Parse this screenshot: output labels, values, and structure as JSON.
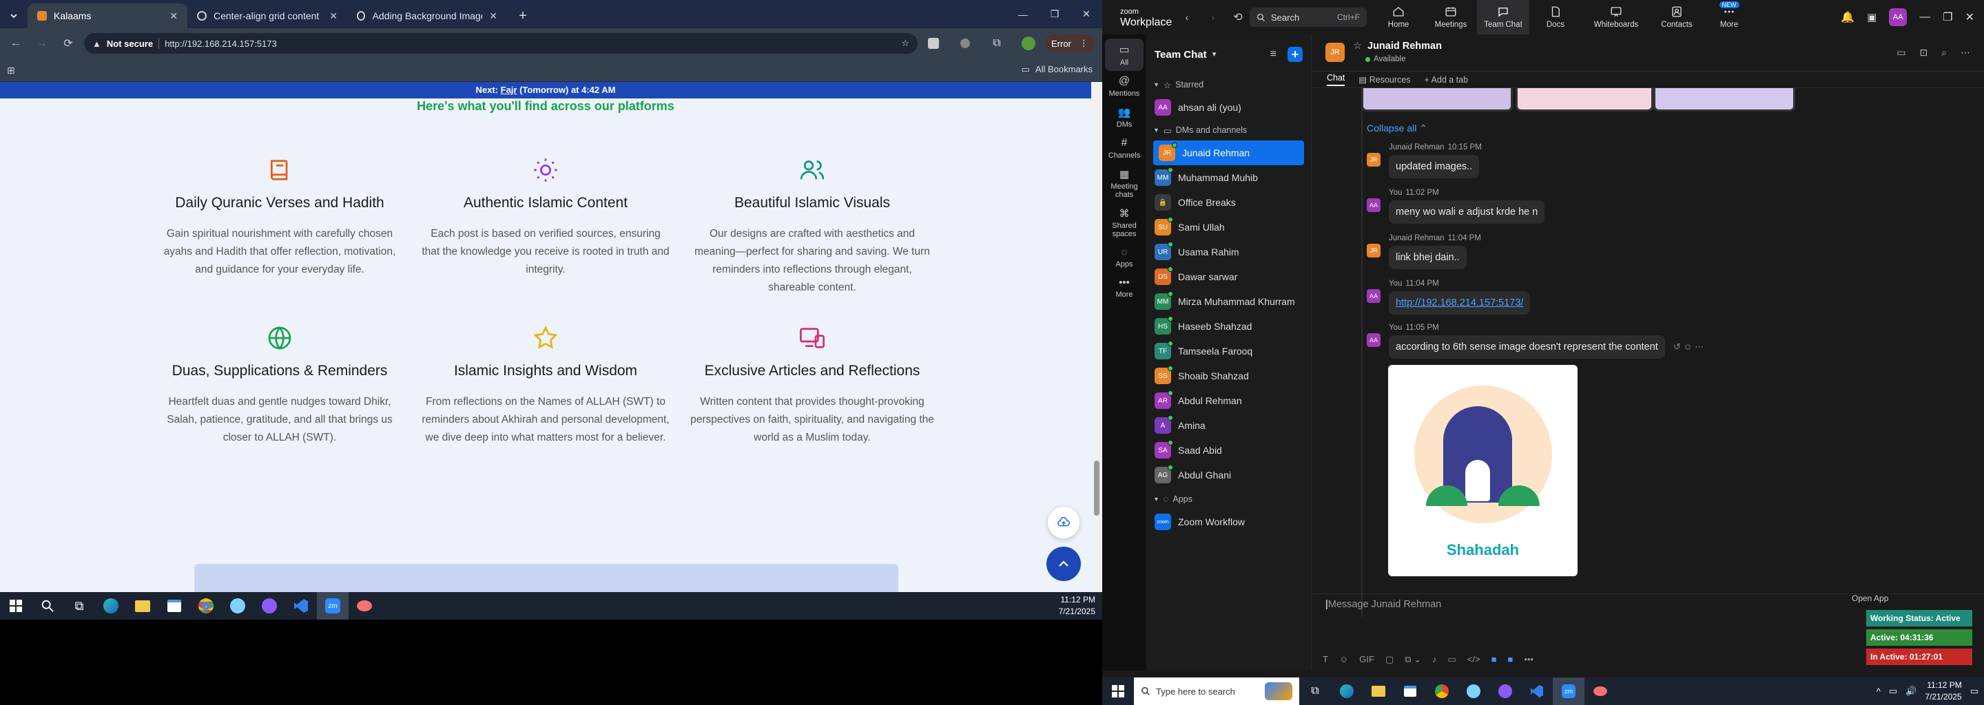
{
  "browser": {
    "tabs": [
      {
        "title": "Kalaams",
        "active": true
      },
      {
        "title": "Center-align grid content",
        "active": false
      },
      {
        "title": "Adding Background Image to I",
        "active": false
      }
    ],
    "security": "Not secure",
    "url": "http://192.168.214.157:5173",
    "profile": "Error",
    "bookmarks": "All Bookmarks"
  },
  "page": {
    "prayer_bar_prefix": "Next: ",
    "prayer_bar_name": "Fajr",
    "prayer_bar_suffix": " (Tomorrow) at 4:42 AM",
    "heading": "Here's what you'll find across our platforms",
    "features": [
      {
        "icon": "book-icon",
        "title": "Daily Quranic Verses and Hadith",
        "desc": "Gain spiritual nourishment with carefully chosen ayahs and Hadith that offer reflection, motivation, and guidance for your everyday life."
      },
      {
        "icon": "sun-icon",
        "title": "Authentic Islamic Content",
        "desc": "Each post is based on verified sources, ensuring that the knowledge you receive is rooted in truth and integrity."
      },
      {
        "icon": "users-icon",
        "title": "Beautiful Islamic Visuals",
        "desc": "Our designs are crafted with aesthetics and meaning—perfect for sharing and saving. We turn reminders into reflections through elegant, shareable content."
      },
      {
        "icon": "globe-icon",
        "title": "Duas, Supplications & Reminders",
        "desc": "Heartfelt duas and gentle nudges toward Dhikr, Salah, patience, gratitude, and all that brings us closer to ALLAH (SWT)."
      },
      {
        "icon": "star-icon",
        "title": "Islamic Insights and Wisdom",
        "desc": "From reflections on the Names of ALLAH (SWT) to reminders about Akhirah and personal development, we dive deep into what matters most for a believer."
      },
      {
        "icon": "devices-icon",
        "title": "Exclusive Articles and Reflections",
        "desc": "Written content that provides thought-provoking perspectives on faith, spirituality, and navigating the world as a Muslim today."
      }
    ]
  },
  "taskbar1": {
    "time": "11:12 PM",
    "date": "7/21/2025"
  },
  "zoom": {
    "brand_top": "zoom",
    "brand_bottom": "Workplace",
    "search_label": "Search",
    "search_shortcut": "Ctrl+F",
    "nav": [
      "Home",
      "Meetings",
      "Team Chat",
      "Docs",
      "Whiteboards",
      "Contacts",
      "More"
    ],
    "new_badge": "NEW",
    "user_initials": "AA",
    "rail": [
      "All",
      "Mentions",
      "DMs",
      "Channels",
      "Meeting chats",
      "Shared spaces",
      "Apps",
      "More"
    ],
    "list_title": "Team Chat",
    "starred": "Starred",
    "self_name": "ahsan ali (you)",
    "dms_channels": "DMs and channels",
    "contacts": [
      {
        "name": "Junaid Rehman",
        "initials": "JR",
        "color": "#e8862a",
        "selected": true
      },
      {
        "name": "Muhammad Muhib",
        "initials": "MM",
        "color": "#2e6fb8"
      },
      {
        "name": "Office Breaks",
        "initials": "",
        "color": "#3a3a3a"
      },
      {
        "name": "Sami Ullah",
        "initials": "SU",
        "color": "#e8862a"
      },
      {
        "name": "Usama Rahim",
        "initials": "UR",
        "color": "#2e6fb8"
      },
      {
        "name": "Dawar sarwar",
        "initials": "DS",
        "color": "#e06a2a"
      },
      {
        "name": "Mirza Muhammad Khurram",
        "initials": "MM",
        "color": "#2a8a5a"
      },
      {
        "name": "Haseeb Shahzad",
        "initials": "HS",
        "color": "#2a8a5a"
      },
      {
        "name": "Tamseela Farooq",
        "initials": "TF",
        "color": "#2a8a7a"
      },
      {
        "name": "Shoaib Shahzad",
        "initials": "SS",
        "color": "#e8862a"
      },
      {
        "name": "Abdul Rehman",
        "initials": "AR",
        "color": "#a03ab8"
      },
      {
        "name": "Amina",
        "initials": "A",
        "color": "#7a3ab8"
      },
      {
        "name": "Saad Abid",
        "initials": "SA",
        "color": "#a03ab8"
      },
      {
        "name": "Abdul Ghani",
        "initials": "AG",
        "color": "#666"
      }
    ],
    "apps_label": "Apps",
    "app_item": "Zoom Workflow",
    "chat_header": {
      "initials": "JR",
      "name": "Junaid Rehman",
      "status": "Available"
    },
    "chat_tabs": [
      "Chat",
      "Resources",
      "Add a tab"
    ],
    "collapse": "Collapse all",
    "messages": [
      {
        "sender": "Junaid Rehman",
        "time": "10:15 PM",
        "text": "updated images..",
        "initials": "JR",
        "color": "#e8862a"
      },
      {
        "sender": "You",
        "time": "11:02 PM",
        "text": "meny wo wali e adjust krde he n",
        "initials": "AA",
        "color": "#a03ab8"
      },
      {
        "sender": "Junaid Rehman",
        "time": "11:04 PM",
        "text": "link bhej dain..",
        "initials": "JR",
        "color": "#e8862a"
      },
      {
        "sender": "You",
        "time": "11:04 PM",
        "text": "http://192.168.214.157:5173/",
        "initials": "AA",
        "color": "#a03ab8",
        "link": true
      },
      {
        "sender": "You",
        "time": "11:05 PM",
        "text": "according to 6th sense image doesn't represent the content",
        "initials": "AA",
        "color": "#a03ab8"
      }
    ],
    "image_caption": "Shahadah",
    "composer_placeholder": "Message Junaid Rehman",
    "open_app": "Open App",
    "working_status": "Working Status: Active",
    "active_time": "Active: 04:31:36",
    "inactive_time": "In Active: 01:27:01"
  },
  "taskbar2": {
    "search_placeholder": "Type here to search",
    "time": "11:12 PM",
    "date": "7/21/2025"
  }
}
